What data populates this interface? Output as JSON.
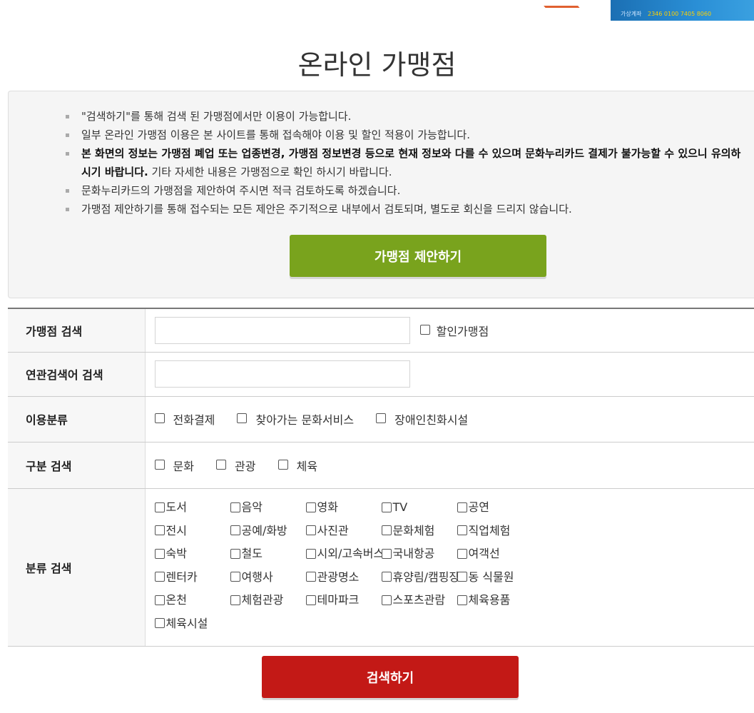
{
  "banner": {
    "text": "가상계좌",
    "number": "2346 0100 7405 8060"
  },
  "page": {
    "title": "온라인 가맹점"
  },
  "notice": {
    "items": [
      "\"검색하기\"를 통해 검색 된 가맹점에서만 이용이 가능합니다.",
      "일부 온라인 가맹점 이용은 본 사이트를 통해 접속해야 이용 및 할인 적용이 가능합니다.",
      "문화누리카드의 가맹점을 제안하여 주시면 적극 검토하도록 하겠습니다.",
      "가맹점 제안하기를 통해 접수되는 모든 제안은 주기적으로 내부에서 검토되며, 별도로 회신을 드리지 않습니다."
    ],
    "bold_item_bold": "본 화면의 정보는 가맹점 폐업 또는 업종변경, 가맹점 정보변경 등으로 현재 정보와 다를 수 있으며 문화누리카드 결제가 불가능할 수 있으니 유의하시기 바랍니다.",
    "bold_item_rest": " 기타 자세한 내용은 가맹점으로 확인 하시기 바랍니다.",
    "suggest_button": "가맹점 제안하기"
  },
  "form": {
    "store_search_label": "가맹점 검색",
    "store_search_value": "",
    "discount_label": "할인가맹점",
    "related_search_label": "연관검색어 검색",
    "related_search_value": "",
    "use_type_label": "이용분류",
    "use_types": [
      "전화결제",
      "찾아가는 문화서비스",
      "장애인친화시설"
    ],
    "gubun_label": "구분 검색",
    "gubun_types": [
      "문화",
      "관광",
      "체육"
    ],
    "category_label": "분류 검색",
    "categories": [
      "도서",
      "음악",
      "영화",
      "TV",
      "공연",
      "전시",
      "공예/화방",
      "사진관",
      "문화체험",
      "직업체험",
      "숙박",
      "철도",
      "시외/고속버스",
      "국내항공",
      "여객선",
      "렌터카",
      "여행사",
      "관광명소",
      "휴양림/캠핑장",
      "동 식물원",
      "온천",
      "체험관광",
      "테마파크",
      "스포츠관람",
      "체육용품",
      "체육시설"
    ]
  },
  "search_button": "검색하기"
}
